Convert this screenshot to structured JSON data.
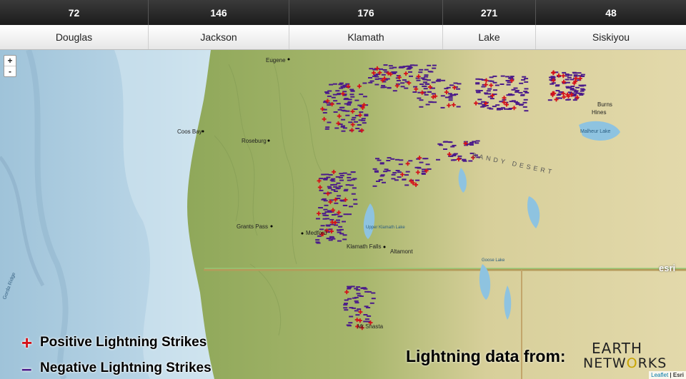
{
  "counties": [
    {
      "name": "Douglas",
      "count": "72"
    },
    {
      "name": "Jackson",
      "count": "146"
    },
    {
      "name": "Klamath",
      "count": "176"
    },
    {
      "name": "Lake",
      "count": "271"
    },
    {
      "name": "Siskiyou",
      "count": "48"
    }
  ],
  "zoom": {
    "in": "+",
    "out": "-"
  },
  "legend": {
    "positive_symbol": "+",
    "positive_label": "Positive Lightning Strikes",
    "negative_symbol": "–",
    "negative_label": "Negative Lightning Strikes",
    "positive_color": "#d4121a",
    "negative_color": "#4b1b8a"
  },
  "source": "Lightning data from:",
  "logo": {
    "line1_a": "ARTH",
    "line1_prefix": "E",
    "line2_a": "NETW",
    "line2_accent": "O",
    "line2_b": "RKS"
  },
  "attribution": {
    "leaflet": "Leaflet",
    "sep": " | ",
    "esri": "Esri"
  },
  "esri_mark": "esri",
  "map_labels": [
    {
      "text": "Eugene"
    },
    {
      "text": "Coos Bay"
    },
    {
      "text": "Roseburg"
    },
    {
      "text": "Grants Pass"
    },
    {
      "text": "Medford"
    },
    {
      "text": "Klamath Falls"
    },
    {
      "text": "Altamont"
    },
    {
      "text": "Mt Shasta"
    },
    {
      "text": "Burns"
    },
    {
      "text": "Hines"
    },
    {
      "text": "Malheur Lake"
    },
    {
      "text": "Goose Lake"
    },
    {
      "text": "Upper Klamath Lake"
    },
    {
      "text": "SANDY DESERT"
    },
    {
      "text": "Gorda Ridge"
    }
  ]
}
